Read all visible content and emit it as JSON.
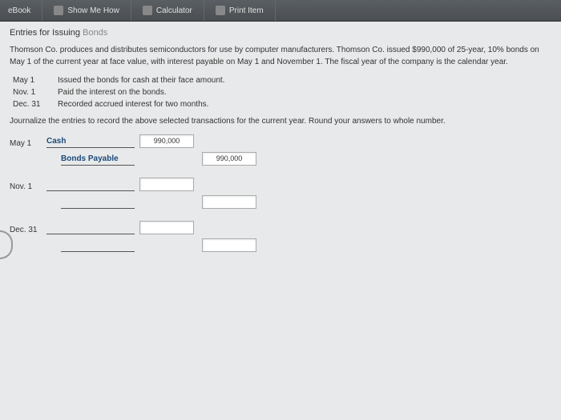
{
  "toolbar": {
    "ebook": "eBook",
    "show": "Show Me How",
    "calc": "Calculator",
    "print": "Print Item"
  },
  "title": {
    "main": "Entries for Issuing",
    "muted": "Bonds"
  },
  "problem": "Thomson Co. produces and distributes semiconductors for use by computer manufacturers. Thomson Co. issued $990,000 of 25-year, 10% bonds on May 1 of the current year at face value, with interest payable on May 1 and November 1. The fiscal year of the company is the calendar year.",
  "events": [
    {
      "date": "May 1",
      "text": "Issued the bonds for cash at their face amount."
    },
    {
      "date": "Nov. 1",
      "text": "Paid the interest on the bonds."
    },
    {
      "date": "Dec. 31",
      "text": "Recorded accrued interest for two months."
    }
  ],
  "instr": "Journalize the entries to record the above selected transactions for the current year. Round your answers to whole number.",
  "journal": {
    "may1": {
      "date": "May 1",
      "debitAcct": "Cash",
      "debitAmt": "990,000",
      "creditAcct": "Bonds Payable",
      "creditAmt": "990,000"
    },
    "nov1": {
      "date": "Nov. 1",
      "debitAcct": "",
      "debitAmt": "",
      "creditAcct": "",
      "creditAmt": ""
    },
    "dec31": {
      "date": "Dec. 31",
      "debitAcct": "",
      "debitAmt": "",
      "creditAcct": "",
      "creditAmt": ""
    }
  }
}
